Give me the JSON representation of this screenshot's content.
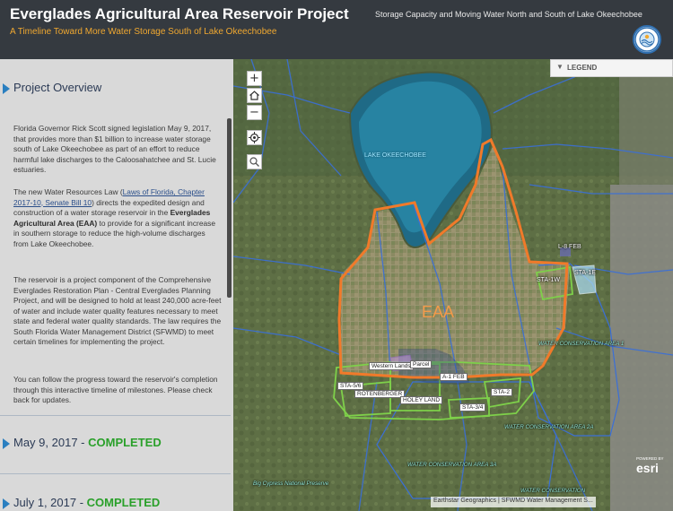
{
  "header": {
    "title": "Everglades Agricultural Area Reservoir Project",
    "subtitle": "A Timeline Toward More Water Storage South of Lake Okeechobee",
    "tab_text": "Storage Capacity and Moving Water North and South of Lake Okeechobee",
    "logo_icon": "sfwmd-seal-logo"
  },
  "panel": {
    "overview_title": "Project Overview",
    "paragraphs": {
      "p1": "Florida Governor Rick Scott signed legislation May 9, 2017, that provides more than $1 billion to increase water storage south of Lake Okeechobee as part of an effort to reduce harmful lake discharges to the Caloosahatchee and St. Lucie estuaries.",
      "p2_a": "The new Water Resources Law (",
      "p2_link": "Laws of Florida, Chapter 2017-10, Senate Bill 10",
      "p2_b": ") directs the expedited design and construction of a water storage reservoir in the ",
      "p2_bold": "Everglades Agricultural Area (EAA)",
      "p2_c": " to provide for a significant increase in southern storage to reduce the high-volume discharges from Lake Okeechobee.",
      "p3": "The reservoir is a project component of the Comprehensive Everglades Restoration Plan - Central Everglades Planning Project, and will be designed to hold at least 240,000 acre-feet of water and include water quality features necessary to meet state and federal water quality standards. The law requires the South Florida Water Management District (SFWMD) to meet certain timelines for implementing the project.",
      "p4": "You can follow the progress toward the reservoir's completion through this interactive timeline of milestones. Please check back for updates."
    },
    "milestones": [
      {
        "date": "May 9, 2017 - ",
        "status": "COMPLETED"
      },
      {
        "date": "July 1, 2017 - ",
        "status": "COMPLETED"
      }
    ]
  },
  "map": {
    "controls": {
      "zoom_in": "+",
      "zoom_out": "−",
      "home_icon": "home-icon",
      "locate_icon": "locate-icon",
      "search_icon": "search-icon"
    },
    "legend_label": "LEGEND",
    "labels": {
      "lake": "LAKE OKEECHOBEE",
      "eaa": "EAA",
      "l8": "L-8 FEB",
      "sta1e": "STA-1E",
      "sta1w": "STA-1W",
      "wca1": "WATER CONSERVATION AREA 1",
      "western": "Western Lands",
      "parcel": "Parcel",
      "a1": "A-1 FEB",
      "sta56": "STA-5/6",
      "rotenberger": "ROTENBERGER",
      "holey": "HOLEY LAND",
      "sta34": "STA-3/4",
      "sta2": "STA-2",
      "wca2a": "WATER CONSERVATION AREA 2A",
      "wca3a": "WATER CONSERVATION AREA 3A",
      "big_cypress": "Big Cypress National Preserve",
      "wca3b": "WATER CONSERVATION"
    },
    "attribution": "Earthstar Geographics  |  SFWMD Water Management S...",
    "powered_by": "POWERED BY",
    "esri": "esri"
  },
  "colors": {
    "header_bg": "#353a40",
    "subtitle": "#f0a830",
    "panel_bg": "#d9d9d9",
    "accent_blue": "#2a7fc0",
    "completed_green": "#2aa02a",
    "eaa_outline": "#f07a2a",
    "sta_outline": "#7ed04a",
    "reservoir_outline": "#2b3f7a"
  }
}
